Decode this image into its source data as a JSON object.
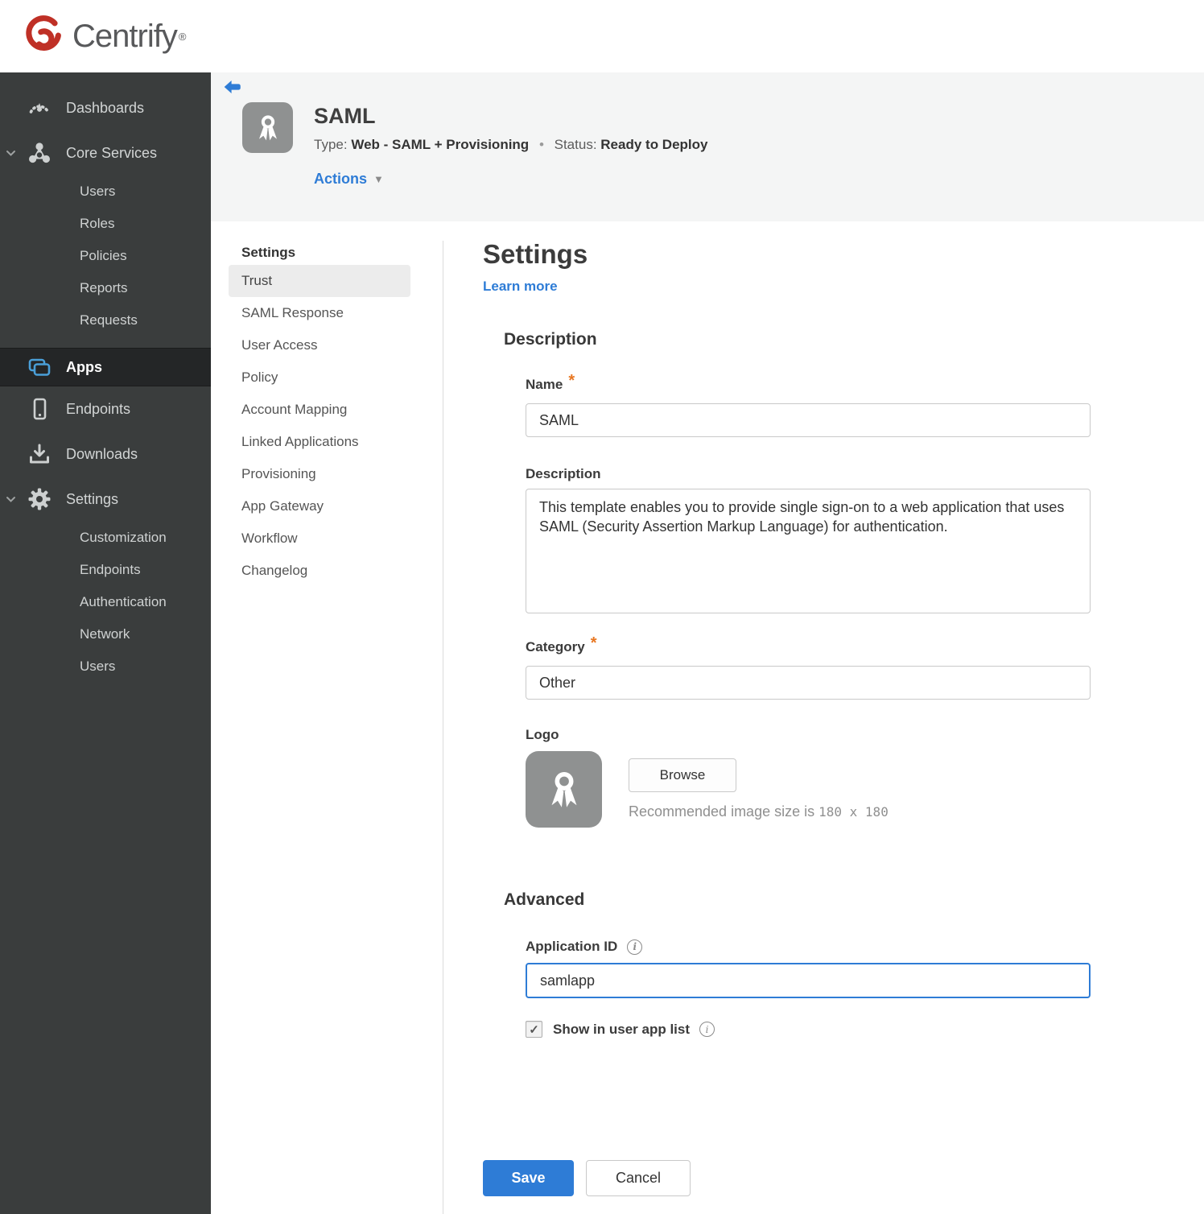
{
  "brand": {
    "name": "Centrify",
    "trademark": "®"
  },
  "colors": {
    "accent_blue": "#2e7cd6",
    "status_red": "#a8231e",
    "brand_red": "#bf3026",
    "sidebar_bg": "#3a3d3d",
    "apps_icon_blue": "#4a9fd8"
  },
  "sidebar": {
    "dashboards": "Dashboards",
    "core_services": "Core Services",
    "core_children": [
      "Users",
      "Roles",
      "Policies",
      "Reports",
      "Requests"
    ],
    "apps": "Apps",
    "endpoints": "Endpoints",
    "downloads": "Downloads",
    "settings": "Settings",
    "settings_children": [
      "Customization",
      "Endpoints",
      "Authentication",
      "Network",
      "Users"
    ]
  },
  "app_header": {
    "title": "SAML",
    "type_label": "Type:",
    "type_value": "Web - SAML + Provisioning",
    "separator": "•",
    "status_label": "Status:",
    "status_value": "Ready to Deploy",
    "actions_label": "Actions"
  },
  "subnav": {
    "header": "Settings",
    "selected": "Trust",
    "items": [
      "Trust",
      "SAML Response",
      "User Access",
      "Policy",
      "Account Mapping",
      "Linked Applications",
      "Provisioning",
      "App Gateway",
      "Workflow",
      "Changelog"
    ]
  },
  "main": {
    "title": "Settings",
    "learn_more": "Learn more",
    "required_mark": "*",
    "description": {
      "heading": "Description",
      "name_label": "Name",
      "name_value": "SAML",
      "description_label": "Description",
      "description_value": "This template enables you to provide single sign-on to a web application that uses SAML (Security Assertion Markup Language) for authentication.",
      "category_label": "Category",
      "category_value": "Other",
      "logo_label": "Logo",
      "browse_label": "Browse",
      "logo_hint_text": "Recommended image size is",
      "logo_hint_size": "180 x 180"
    },
    "advanced": {
      "heading": "Advanced",
      "app_id_label": "Application ID",
      "app_id_value": "samlapp",
      "show_label": "Show in user app list",
      "checked": true
    },
    "footer": {
      "save": "Save",
      "cancel": "Cancel"
    }
  },
  "icons": {
    "check": "✓",
    "info": "i",
    "caret_down": "▼"
  }
}
